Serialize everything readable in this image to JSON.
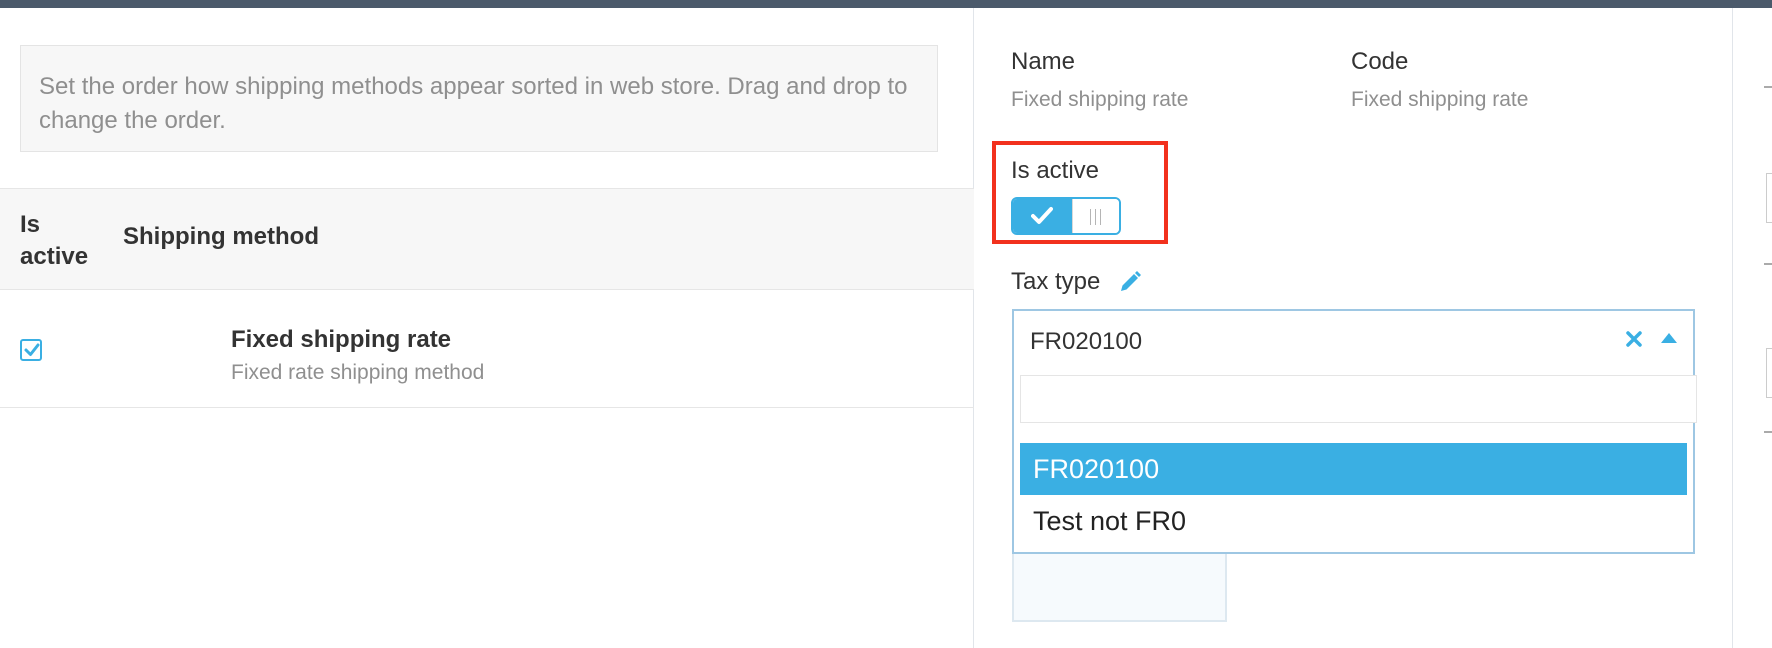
{
  "left_panel": {
    "info_text": "Set the order how shipping methods appear sorted in web store. Drag and drop to change the order.",
    "table": {
      "headers": {
        "is_active": "Is active",
        "shipping_method": "Shipping method"
      },
      "rows": [
        {
          "active": true,
          "title": "Fixed shipping rate",
          "subtitle": "Fixed rate shipping method"
        }
      ]
    }
  },
  "right_panel": {
    "name_label": "Name",
    "name_value": "Fixed shipping rate",
    "code_label": "Code",
    "code_value": "Fixed shipping rate",
    "is_active_label": "Is active",
    "is_active_value": true,
    "tax_type_label": "Tax type",
    "tax_type_selected": "FR020100",
    "tax_type_search": "",
    "tax_type_options": [
      "FR020100",
      "Test not FR0"
    ],
    "tax_type_highlighted": "FR020100"
  },
  "colors": {
    "accent": "#3aafe3",
    "highlight": "#f2311d",
    "topbar": "#4b5a6b"
  },
  "icons": {
    "toggle_on": "check-icon",
    "toggle_knob": "grip-icon",
    "edit": "pencil-icon",
    "clear": "clear-icon",
    "open": "caret-up-icon",
    "checkbox": "checkbox-checked-icon"
  }
}
